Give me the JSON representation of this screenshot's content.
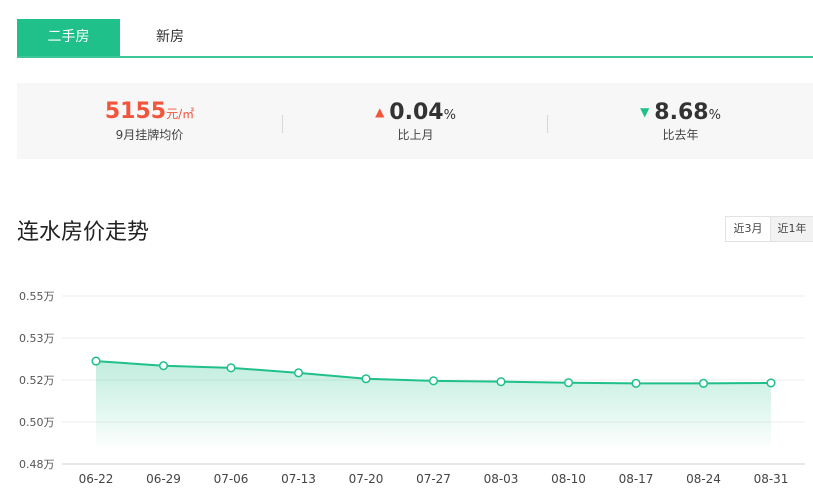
{
  "tabs": [
    {
      "label": "二手房",
      "active": true
    },
    {
      "label": "新房",
      "active": false
    }
  ],
  "stats": {
    "avg_price": {
      "value": "5155",
      "unit": "元/㎡",
      "label": "9月挂牌均价"
    },
    "mom": {
      "arrow": "▲",
      "value": "0.04",
      "pct": "%",
      "label": "比上月"
    },
    "yoy": {
      "arrow": "▼",
      "value": "8.68",
      "pct": "%",
      "label": "比去年"
    }
  },
  "section_title": "连水房价走势",
  "range_buttons": {
    "three_months": "近3月",
    "one_year": "近1年"
  },
  "colors": {
    "accent": "#20c08a",
    "price_red": "#f3553c"
  },
  "chart_data": {
    "type": "line",
    "y_unit": "万",
    "x": [
      "06-22",
      "06-29",
      "07-06",
      "07-13",
      "07-20",
      "07-27",
      "08-03",
      "08-10",
      "08-17",
      "08-24",
      "08-31"
    ],
    "values": [
      0.5245,
      0.5234,
      0.5229,
      0.5217,
      0.5203,
      0.5196,
      0.5192,
      0.5187,
      0.5184,
      0.5184,
      0.5186
    ],
    "ylim": [
      0.48,
      0.55
    ],
    "y_ticks": [
      {
        "value": 0.55,
        "label": "0.55万"
      },
      {
        "value": 0.53,
        "label": "0.53万"
      },
      {
        "value": 0.52,
        "label": "0.52万"
      },
      {
        "value": 0.5,
        "label": "0.50万"
      },
      {
        "value": 0.48,
        "label": "0.48万"
      }
    ],
    "grid": true,
    "area_fill": true,
    "color": "#20c08a"
  }
}
